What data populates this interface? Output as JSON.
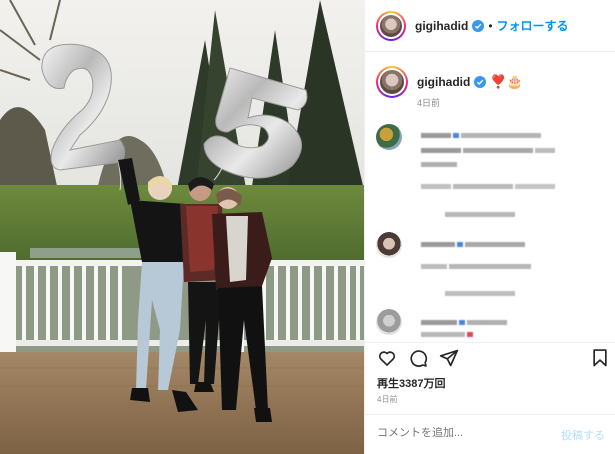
{
  "header": {
    "username": "gigihadid",
    "separator": "•",
    "follow_label": "フォローする"
  },
  "caption": {
    "username": "gigihadid",
    "emoji": "❣️🎂",
    "time": "4日前"
  },
  "balloons": {
    "left_digit": "2",
    "right_digit": "5"
  },
  "post": {
    "views": "再生3387万回",
    "time": "4日前"
  },
  "comment_box": {
    "placeholder": "コメントを追加...",
    "post_label": "投稿する"
  },
  "icons": [
    "verified-badge-icon",
    "heart-icon",
    "comment-icon",
    "share-icon",
    "bookmark-icon"
  ],
  "colors": {
    "accent": "#0095f6",
    "verified": "#3897f0",
    "text": "#262626",
    "muted": "#8e8e8e",
    "post_disabled": "#b2dffc"
  }
}
